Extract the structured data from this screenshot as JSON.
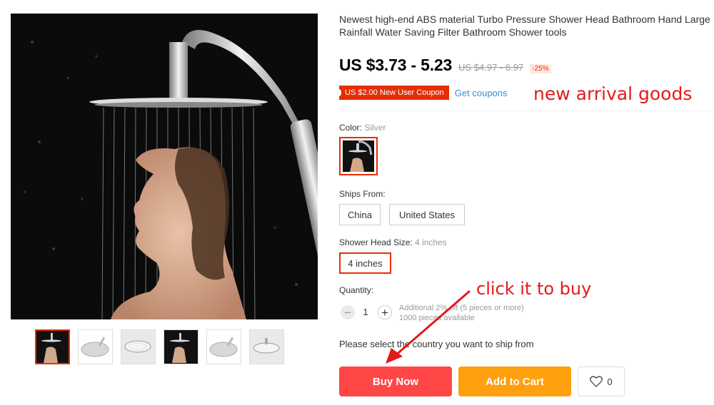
{
  "product": {
    "title": "Newest high-end ABS material Turbo Pressure Shower Head Bathroom Hand Large Rainfall Water Saving Filter Bathroom Shower tools",
    "price": "US $3.73 - 5.23",
    "original_price": "US $4.97 - 6.97",
    "discount": "-25%"
  },
  "coupon": {
    "label": "US $2.00 New User Coupon",
    "link": "Get coupons"
  },
  "annotations": {
    "new_arrival": "new arrival goods",
    "click_to_buy": "click it to buy"
  },
  "options": {
    "color_label": "Color:",
    "color_value": "Silver",
    "ships_label": "Ships From:",
    "ships": [
      "China",
      "United States"
    ],
    "size_label": "Shower Head Size:",
    "size_value": "4 inches",
    "sizes": [
      "4 inches"
    ]
  },
  "quantity": {
    "label": "Quantity:",
    "value": "1",
    "minus": "−",
    "plus": "+",
    "note_line1": "Additional 2% off (5 pieces or more)",
    "note_line2": "1000 pieces available"
  },
  "ship_message": "Please select the country you want to ship from",
  "buttons": {
    "buy_now": "Buy Now",
    "add_to_cart": "Add to Cart",
    "wishlist_count": "0"
  },
  "icons": {
    "wishlist": "heart-icon",
    "annotation_arrow": "arrow-icon"
  },
  "colors": {
    "accent_red": "#ff4747",
    "coupon_red": "#e62e04",
    "cart_orange": "#ffa00f",
    "annotation_red": "#e31a1a",
    "link_blue": "#3a8fd0"
  }
}
